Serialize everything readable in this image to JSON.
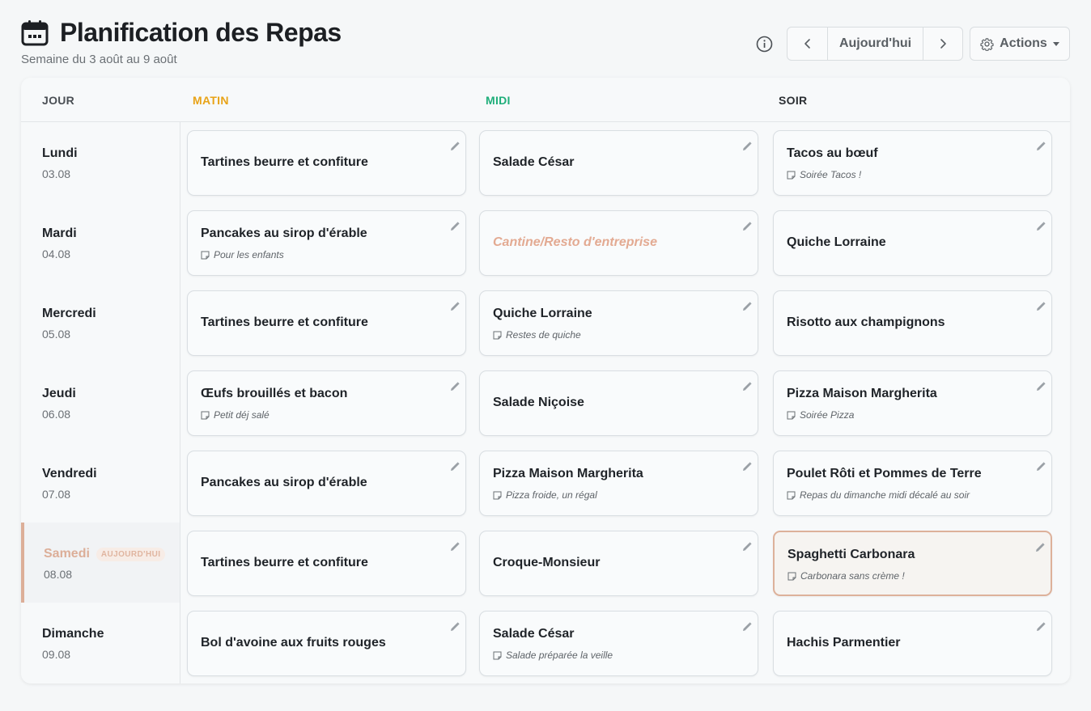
{
  "header": {
    "title": "Planification des Repas",
    "subtitle": "Semaine du 3 août au 9 août"
  },
  "toolbar": {
    "today_label": "Aujourd'hui",
    "actions_label": "Actions"
  },
  "columns": {
    "jour": "JOUR",
    "matin": "MATIN",
    "midi": "MIDI",
    "soir": "SOIR"
  },
  "colors": {
    "matin": "#e8a317",
    "midi": "#1fae7a",
    "today_accent": "#dcae98"
  },
  "today_badge": "AUJOURD'HUI",
  "days": [
    {
      "name": "Lundi",
      "date": "03.08",
      "matin": {
        "meal": "Tartines beurre et confiture",
        "note": ""
      },
      "midi": {
        "meal": "Salade César",
        "note": ""
      },
      "soir": {
        "meal": "Tacos au bœuf",
        "note": "Soirée Tacos !"
      }
    },
    {
      "name": "Mardi",
      "date": "04.08",
      "matin": {
        "meal": "Pancakes au sirop d'érable",
        "note": "Pour les enfants"
      },
      "midi": {
        "meal": "Cantine/Resto d'entreprise",
        "note": ""
      },
      "soir": {
        "meal": "Quiche Lorraine",
        "note": ""
      }
    },
    {
      "name": "Mercredi",
      "date": "05.08",
      "matin": {
        "meal": "Tartines beurre et confiture",
        "note": ""
      },
      "midi": {
        "meal": "Quiche Lorraine",
        "note": "Restes de quiche"
      },
      "soir": {
        "meal": "Risotto aux champignons",
        "note": ""
      }
    },
    {
      "name": "Jeudi",
      "date": "06.08",
      "matin": {
        "meal": "Œufs brouillés et bacon",
        "note": "Petit déj salé"
      },
      "midi": {
        "meal": "Salade Niçoise",
        "note": ""
      },
      "soir": {
        "meal": "Pizza Maison Margherita",
        "note": "Soirée Pizza"
      }
    },
    {
      "name": "Vendredi",
      "date": "07.08",
      "matin": {
        "meal": "Pancakes au sirop d'érable",
        "note": ""
      },
      "midi": {
        "meal": "Pizza Maison Margherita",
        "note": "Pizza froide, un régal"
      },
      "soir": {
        "meal": "Poulet Rôti et Pommes de Terre",
        "note": "Repas du dimanche midi décalé au soir"
      }
    },
    {
      "name": "Samedi",
      "date": "08.08",
      "matin": {
        "meal": "Tartines beurre et confiture",
        "note": ""
      },
      "midi": {
        "meal": "Croque-Monsieur",
        "note": ""
      },
      "soir": {
        "meal": "Spaghetti Carbonara",
        "note": "Carbonara sans crème !"
      }
    },
    {
      "name": "Dimanche",
      "date": "09.08",
      "matin": {
        "meal": "Bol d'avoine aux fruits rouges",
        "note": ""
      },
      "midi": {
        "meal": "Salade César",
        "note": "Salade préparée la veille"
      },
      "soir": {
        "meal": "Hachis Parmentier",
        "note": ""
      }
    }
  ]
}
